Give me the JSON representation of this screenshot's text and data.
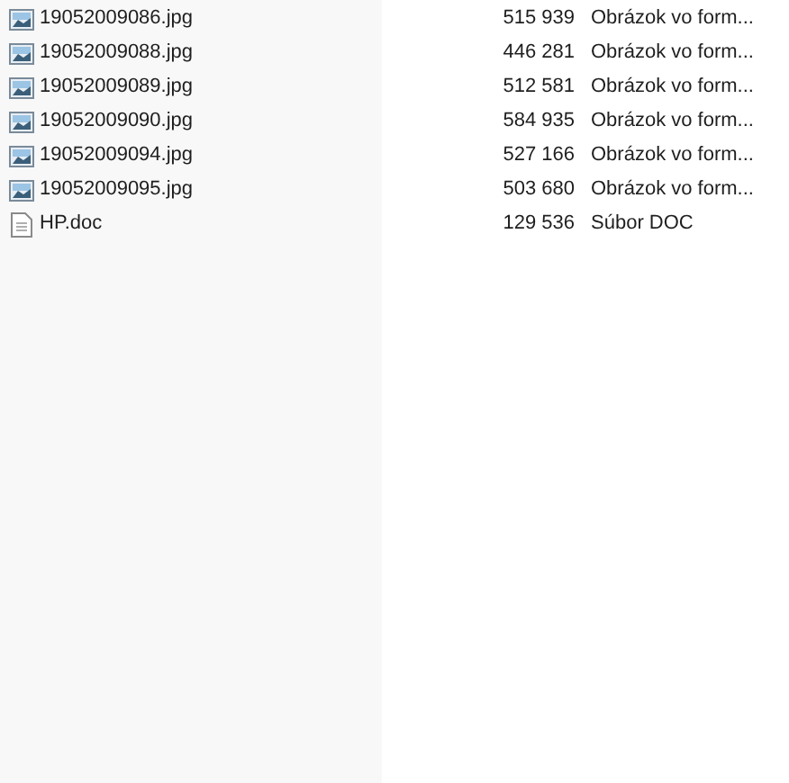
{
  "files": [
    {
      "name": "19052009086.jpg",
      "kind": "image",
      "size": "515 939",
      "type": "Obrázok vo form..."
    },
    {
      "name": "19052009088.jpg",
      "kind": "image",
      "size": "446 281",
      "type": "Obrázok vo form..."
    },
    {
      "name": "19052009089.jpg",
      "kind": "image",
      "size": "512 581",
      "type": "Obrázok vo form..."
    },
    {
      "name": "19052009090.jpg",
      "kind": "image",
      "size": "584 935",
      "type": "Obrázok vo form..."
    },
    {
      "name": "19052009094.jpg",
      "kind": "image",
      "size": "527 166",
      "type": "Obrázok vo form..."
    },
    {
      "name": "19052009095.jpg",
      "kind": "image",
      "size": "503 680",
      "type": "Obrázok vo form..."
    },
    {
      "name": "HP.doc",
      "kind": "document",
      "size": "129 536",
      "type": "Súbor DOC"
    }
  ]
}
